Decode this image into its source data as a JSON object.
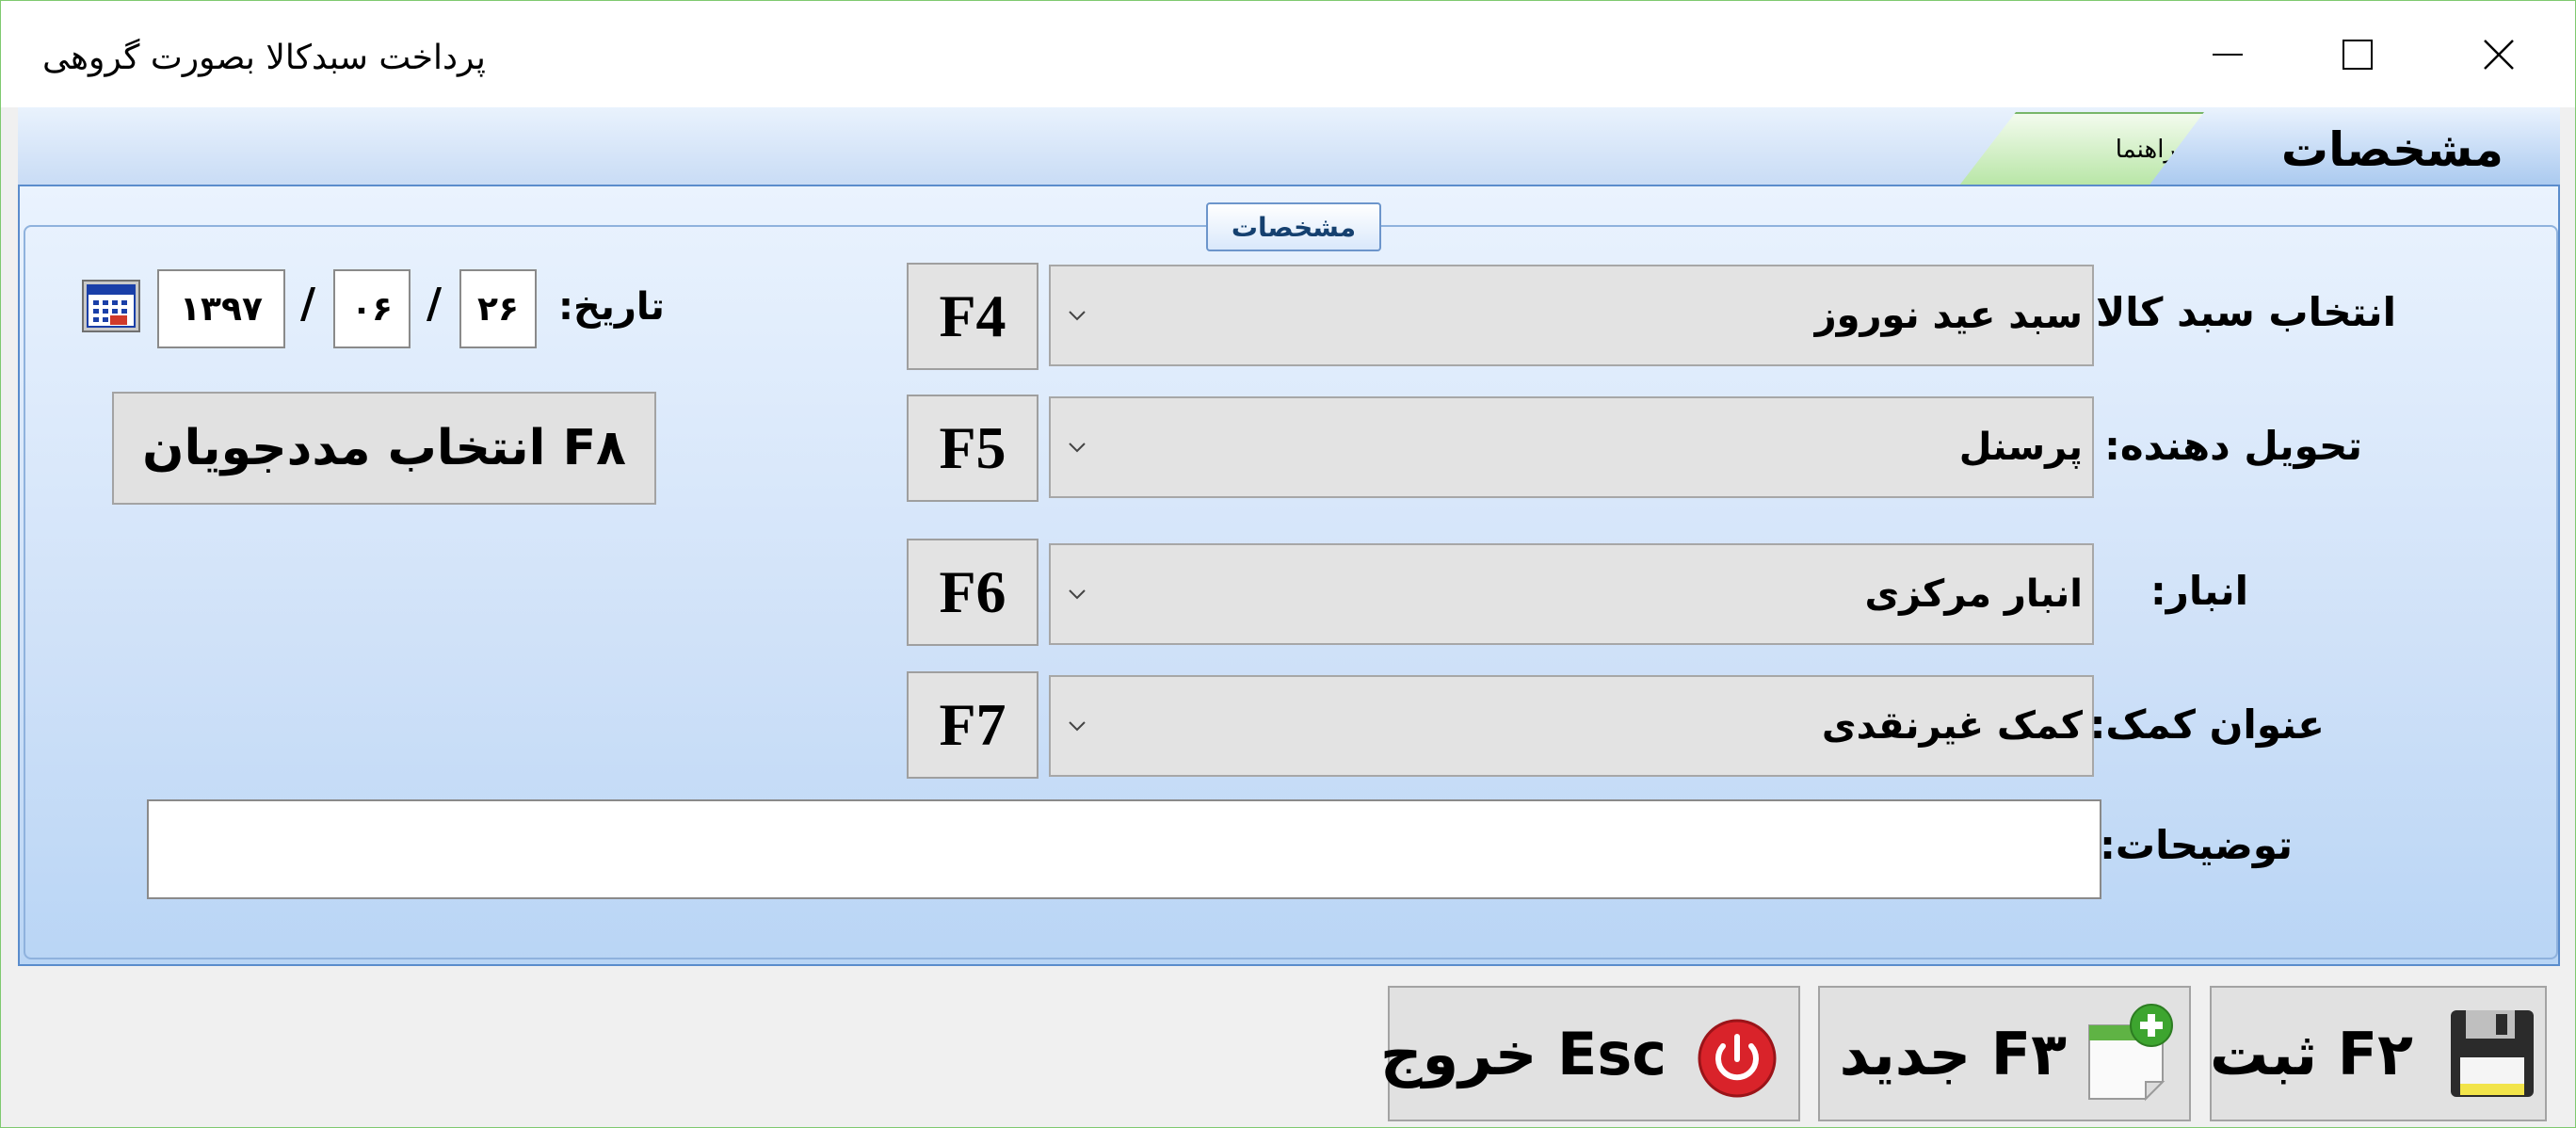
{
  "window": {
    "title": "پرداخت سبدکالا بصورت گروهی"
  },
  "tabs": [
    {
      "label": "مشخصات",
      "active": true
    },
    {
      "label": "راهنما",
      "active": false
    }
  ],
  "group": {
    "title": "مشخصات"
  },
  "fields": {
    "basket": {
      "label": "انتخاب سبد کالا:",
      "value": "سبد عید نوروز",
      "key": "F4"
    },
    "deliverer": {
      "label": "تحویل دهنده:",
      "value": "پرسنل",
      "key": "F5"
    },
    "warehouse": {
      "label": "انبار:",
      "value": "انبار مرکزی",
      "key": "F6"
    },
    "aid_title": {
      "label": "عنوان کمک:",
      "value": "کمک غیرنقدی",
      "key": "F7"
    },
    "description": {
      "label": "توضیحات:",
      "value": ""
    }
  },
  "date": {
    "label": "تاریخ:",
    "day": "۲۶",
    "month": "۰۶",
    "year": "۱۳۹۷",
    "separator": "/"
  },
  "select_students_button": "F۸ انتخاب مددجویان",
  "actions": {
    "save": "ثبت F۲",
    "new": "جدید F۳",
    "exit": "خروج Esc"
  },
  "colors": {
    "panel_border": "#5a8ccc",
    "tab_help": "#b8e6a6",
    "window_border": "#7fc96f"
  }
}
